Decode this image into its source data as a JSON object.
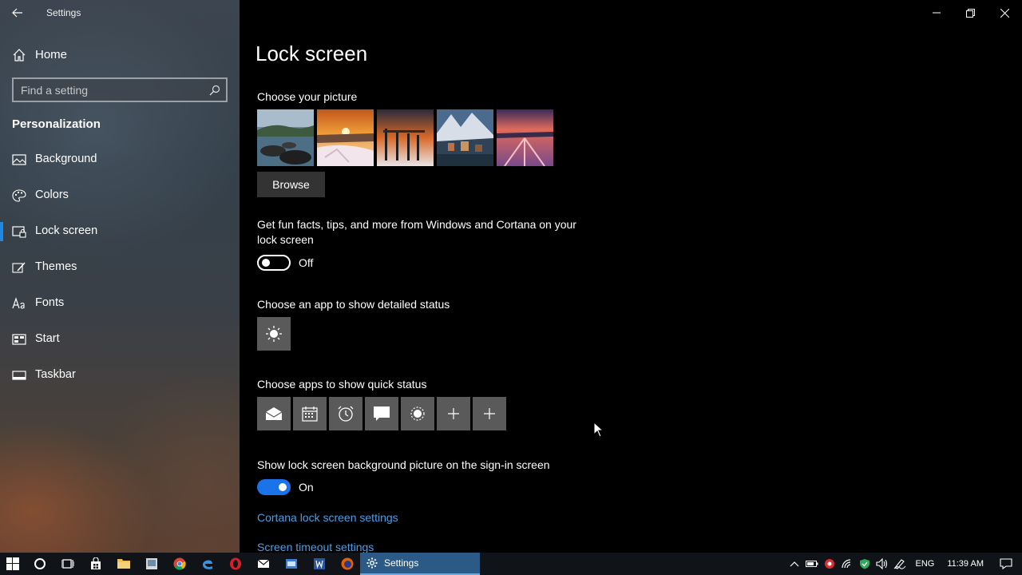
{
  "window": {
    "app_title": "Settings"
  },
  "sidebar": {
    "home_label": "Home",
    "search_placeholder": "Find a setting",
    "section_title": "Personalization",
    "items": [
      {
        "label": "Background",
        "icon": "image-icon",
        "active": false
      },
      {
        "label": "Colors",
        "icon": "palette-icon",
        "active": false
      },
      {
        "label": "Lock screen",
        "icon": "lock-screen-icon",
        "active": true
      },
      {
        "label": "Themes",
        "icon": "brush-icon",
        "active": false
      },
      {
        "label": "Fonts",
        "icon": "font-icon",
        "active": false
      },
      {
        "label": "Start",
        "icon": "start-icon",
        "active": false
      },
      {
        "label": "Taskbar",
        "icon": "taskbar-icon",
        "active": false
      }
    ]
  },
  "main": {
    "title": "Lock screen",
    "choose_picture_label": "Choose your picture",
    "browse_label": "Browse",
    "fun_facts_text": "Get fun facts, tips, and more from Windows and Cortana on your lock screen",
    "fun_facts_state": "Off",
    "detailed_status_label": "Choose an app to show detailed status",
    "quick_status_label": "Choose apps to show quick status",
    "quick_status_apps": [
      "mail-icon",
      "calendar-icon",
      "alarm-icon",
      "message-icon",
      "weather-icon",
      "add-icon",
      "add-icon"
    ],
    "signin_bg_label": "Show lock screen background picture on the sign-in screen",
    "signin_bg_state": "On",
    "cortana_link": "Cortana lock screen settings",
    "timeout_link": "Screen timeout settings"
  },
  "taskbar": {
    "active_app_label": "Settings",
    "language": "ENG",
    "time": "11:39 AM"
  },
  "colors": {
    "accent": "#1a73e8",
    "link": "#4a9fe8",
    "taskbar_active": "#2b5a86"
  }
}
